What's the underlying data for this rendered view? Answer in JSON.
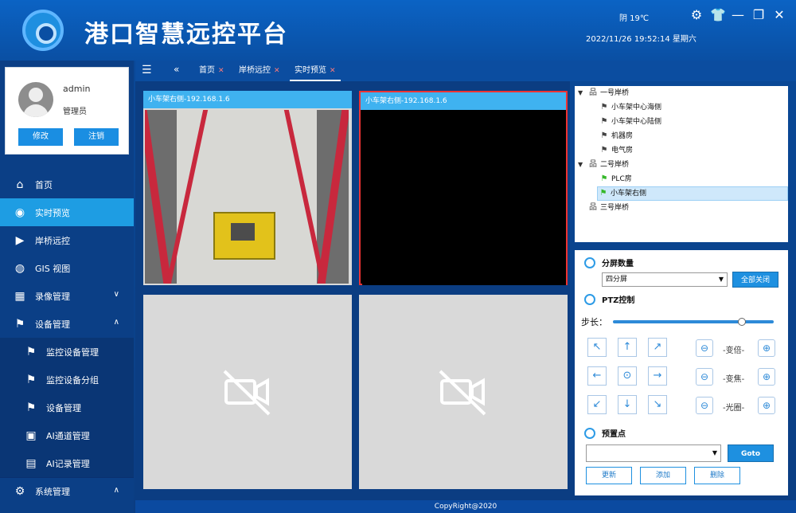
{
  "header": {
    "title": "港口智慧远控平台",
    "weather": "阴 19℃",
    "datetime": "2022/11/26   19:52:14 星期六"
  },
  "user": {
    "name": "admin",
    "role": "管理员",
    "edit_label": "修改",
    "logout_label": "注销"
  },
  "menu": {
    "items": [
      {
        "label": "首页",
        "icon": "home-icon"
      },
      {
        "label": "实时预览",
        "icon": "camera-icon"
      },
      {
        "label": "岸桥远控",
        "icon": "video-icon"
      },
      {
        "label": "GIS 视图",
        "icon": "globe-icon"
      },
      {
        "label": "录像管理",
        "icon": "film-icon"
      },
      {
        "label": "设备管理",
        "icon": "device-icon"
      },
      {
        "label": "监控设备管理",
        "icon": "cctv-icon"
      },
      {
        "label": "监控设备分组",
        "icon": "cctv-icon"
      },
      {
        "label": "设备管理",
        "icon": "cctv-icon"
      },
      {
        "label": "AI通道管理",
        "icon": "ai-icon"
      },
      {
        "label": "AI记录管理",
        "icon": "record-icon"
      },
      {
        "label": "系统管理",
        "icon": "gear-icon"
      }
    ]
  },
  "tabs": [
    {
      "label": "首页"
    },
    {
      "label": "岸桥远控"
    },
    {
      "label": "实时预览"
    }
  ],
  "video": {
    "cells": [
      {
        "title": "小车架右侧-192.168.1.6"
      },
      {
        "title": "小车架右侧-192.168.1.6"
      }
    ]
  },
  "tree": {
    "nodes": [
      {
        "label": "一号岸桥"
      },
      {
        "label": "小车架中心海侧"
      },
      {
        "label": "小车架中心陆侧"
      },
      {
        "label": "机器房"
      },
      {
        "label": "电气房"
      },
      {
        "label": "二号岸桥"
      },
      {
        "label": "PLC房"
      },
      {
        "label": "小车架右侧"
      },
      {
        "label": "三号岸桥"
      }
    ]
  },
  "controls": {
    "split_title": "分屏数量",
    "split_value": "四分屏",
    "close_all": "全部关闭",
    "ptz_title": "PTZ控制",
    "step_label": "步长：",
    "step_value": 0.8,
    "zoom_label": "-变倍-",
    "focus_label": "-变焦-",
    "iris_label": "-光圈-",
    "preset_title": "预置点",
    "goto_label": "Goto",
    "update_label": "更新",
    "add_label": "添加",
    "delete_label": "删除"
  },
  "footer": "CopyRight@2020"
}
